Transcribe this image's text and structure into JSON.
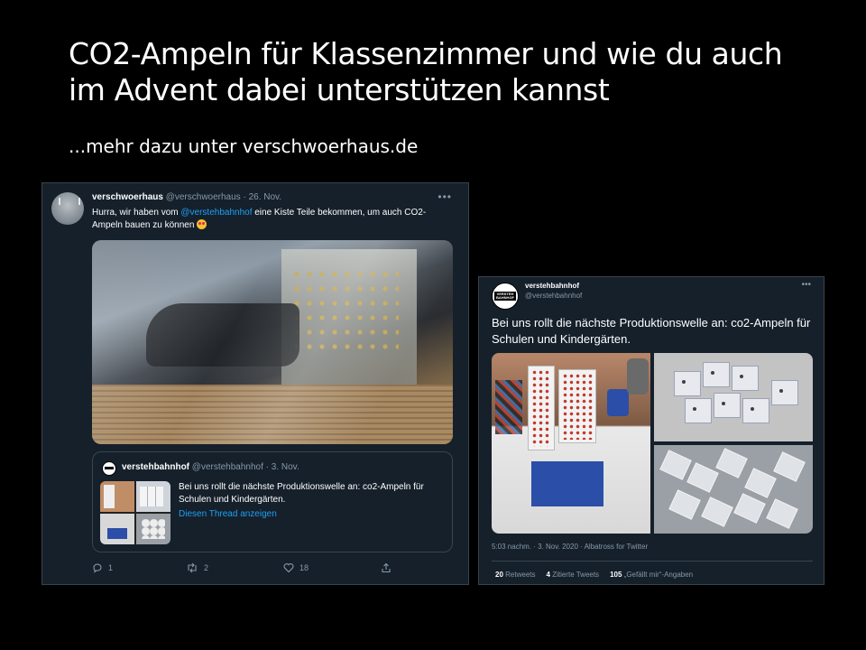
{
  "slide": {
    "title_line1": "CO2-Ampeln für Klassenzimmer und wie du auch",
    "title_line2": "im Advent dabei unterstützen kannst",
    "subtitle": "...mehr dazu unter verschwoerhaus.de"
  },
  "tweet1": {
    "name": "verschwoerhaus",
    "handle": "@verschwoerhaus",
    "date": "· 26. Nov.",
    "more_label": "•••",
    "text_before": "Hurra, wir haben vom ",
    "mention": "@verstehbahnhof",
    "text_after": " eine Kiste Teile bekommen, um auch CO2-Ampeln bauen zu können",
    "emoji": "heart-eyes-emoji",
    "quote": {
      "name": "verstehbahnhof",
      "handle": "@verstehbahnhof",
      "date": "· 3. Nov.",
      "text": "Bei uns rollt die nächste Produktionswelle an: co2-Ampeln für Schulen und Kindergärten.",
      "link": "Diesen Thread anzeigen"
    },
    "actions": {
      "reply_icon": "reply-icon",
      "reply_count": "1",
      "retweet_icon": "retweet-icon",
      "retweet_count": "2",
      "like_icon": "heart-icon",
      "like_count": "18",
      "share_icon": "share-icon"
    }
  },
  "tweet2": {
    "name": "verstehbahnhof",
    "handle": "@verstehbahnhof",
    "avatar_text": "VERSTEH BAHNHOF",
    "more_label": "•••",
    "text": "Bei uns rollt die nächste Produktionswelle an: co2-Ampeln für Schulen und Kindergärten.",
    "meta": "5:03 nachm. · 3. Nov. 2020 · Albatross for Twitter",
    "stats": {
      "retweets_count": "20",
      "retweets_label": "Retweets",
      "quotes_count": "4",
      "quotes_label": "Zitierte Tweets",
      "likes_count": "105",
      "likes_label": "„Gefällt mir“-Angaben"
    }
  },
  "colors": {
    "background": "#000000",
    "tweet_bg": "#15202b",
    "border": "#38444d",
    "link": "#1da1f2",
    "muted": "#8899a6"
  }
}
